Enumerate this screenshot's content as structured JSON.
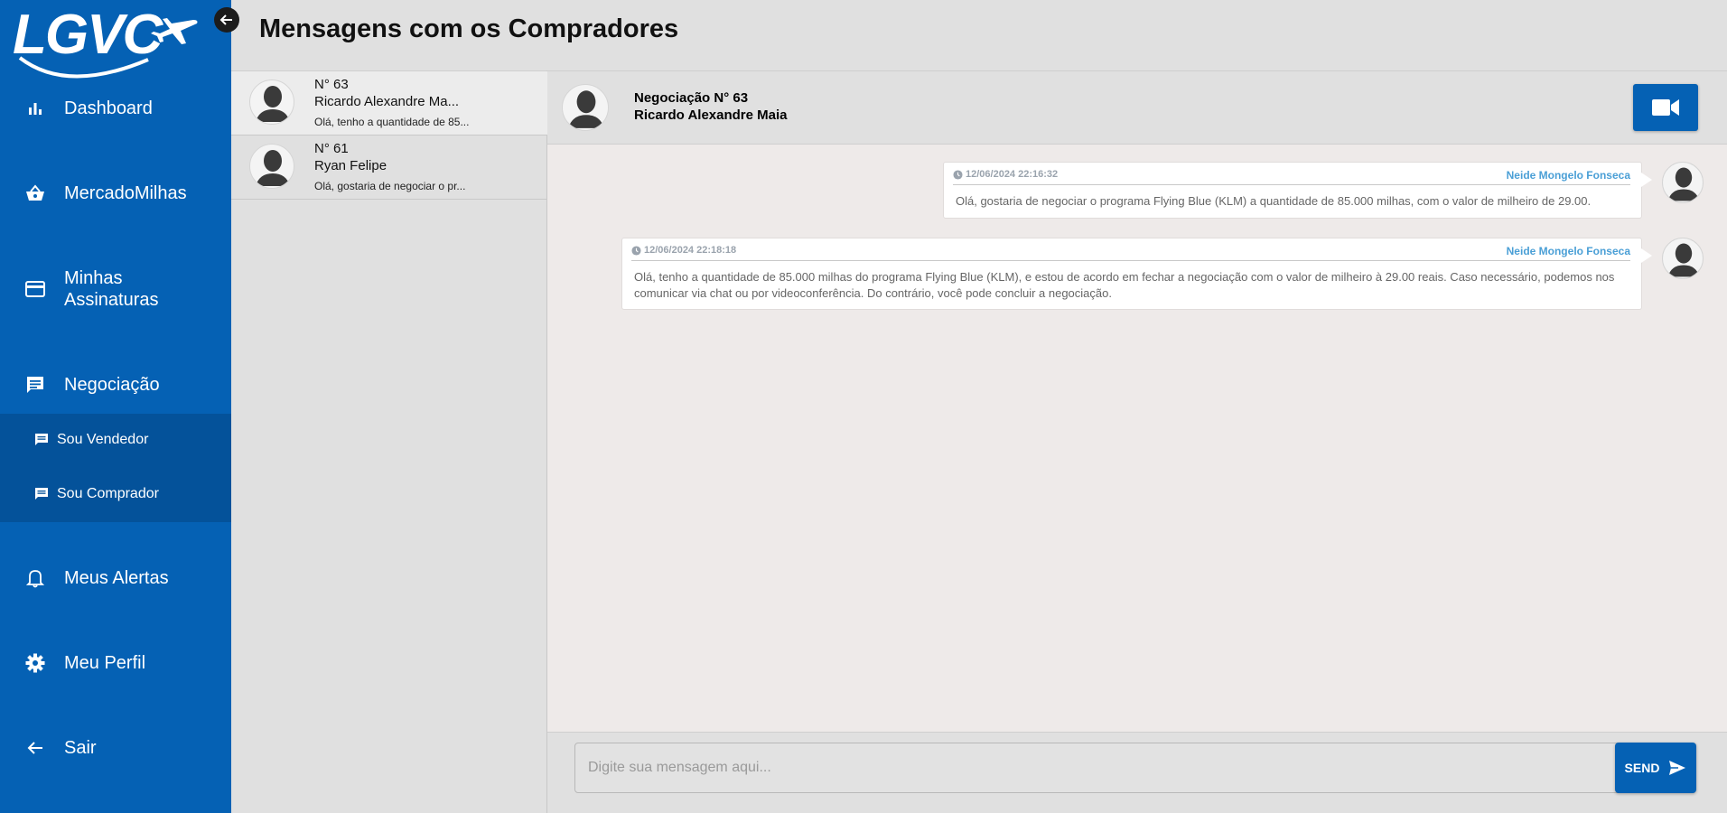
{
  "app": {
    "logo_text": "LGVC",
    "brand_color": "#0561b4"
  },
  "sidebar": {
    "items": [
      {
        "label": "Dashboard",
        "icon": "bar-chart-icon"
      },
      {
        "label": "MercadoMilhas",
        "icon": "basket-icon"
      },
      {
        "label": "Minhas Assinaturas",
        "icon": "credit-card-icon"
      },
      {
        "label": "Negociação",
        "icon": "chat-icon"
      },
      {
        "label": "Meus Alertas",
        "icon": "bell-icon"
      },
      {
        "label": "Meu Perfil",
        "icon": "gear-icon"
      },
      {
        "label": "Sair",
        "icon": "arrow-left-icon"
      }
    ],
    "submenu": [
      {
        "label": "Sou Vendedor",
        "icon": "chat-icon"
      },
      {
        "label": "Sou Comprador",
        "icon": "chat-icon"
      }
    ]
  },
  "header": {
    "title": "Mensagens com os Compradores"
  },
  "conversations": [
    {
      "number": "N° 63",
      "name": "Ricardo Alexandre Ma...",
      "preview": "Olá, tenho a quantidade de 85..."
    },
    {
      "number": "N° 61",
      "name": "Ryan Felipe",
      "preview": "Olá, gostaria de negociar o pr..."
    }
  ],
  "chat": {
    "title": "Negociação N° 63",
    "partner": "Ricardo Alexandre Maia",
    "messages": [
      {
        "timestamp": "12/06/2024 22:16:32",
        "sender": "Neide Mongelo Fonseca",
        "text": "Olá, gostaria de negociar o programa Flying Blue (KLM) a quantidade de 85.000 milhas, com o valor de milheiro de 29.00."
      },
      {
        "timestamp": "12/06/2024 22:18:18",
        "sender": "Neide Mongelo Fonseca",
        "text": "Olá, tenho a quantidade de 85.000 milhas do programa Flying Blue (KLM), e estou de acordo em fechar a negociação com o valor de milheiro à 29.00 reais. Caso necessário, podemos nos comunicar via chat ou por videoconferência. Do contrário, você pode concluir a negociação."
      }
    ],
    "input_placeholder": "Digite sua mensagem aqui...",
    "send_label": "SEND"
  }
}
